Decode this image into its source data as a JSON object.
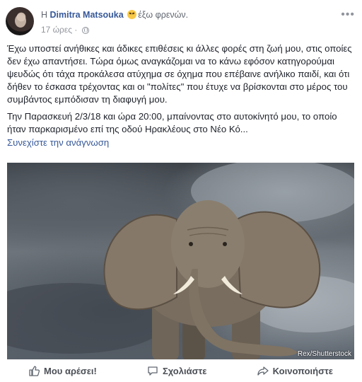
{
  "header": {
    "prefix": "Η",
    "author": "Dimitra Matsouka",
    "feeling_icon": "angry-face-emoji",
    "feeling": "έξω φρενών.",
    "timestamp": "17 ώρες",
    "separator": "·",
    "privacy_icon": "globe-icon",
    "more_icon": "more-horizontal-icon"
  },
  "post": {
    "paragraph1": "Έχω υποστεί ανήθικες και άδικες επιθέσεις κι άλλες φορές στη ζωή μου, στις οποίες δεν έχω απαντήσει. Τώρα όμως αναγκάζομαι να το κάνω εφόσον κατηγορούμαι ψευδώς ότι τάχα προκάλεσα ατύχημα σε όχημα που επέβαινε ανήλικο παιδί, και ότι δήθεν το έσκασα τρέχοντας και οι \"πολίτες\" που έτυχε να βρίσκονται στο μέρος του συμβάντος εμπόδισαν τη διαφυγή μου.",
    "paragraph2": "Την Παρασκευή 2/3/18 και ώρα 20:00, μπαίνοντας στο αυτοκίνητό μου, το οποίο ήταν παρκαρισμένο επί της οδού Ηρακλέους στο Νέο Κό...",
    "see_more": "Συνεχίστε την ανάγνωση"
  },
  "photo": {
    "subject": "elephant-under-stormy-sky",
    "credit": "Rex/Shutterstock"
  },
  "actions": {
    "like_label": "Μου αρέσει!",
    "comment_label": "Σχολιάστε",
    "share_label": "Κοινοποιήστε"
  }
}
